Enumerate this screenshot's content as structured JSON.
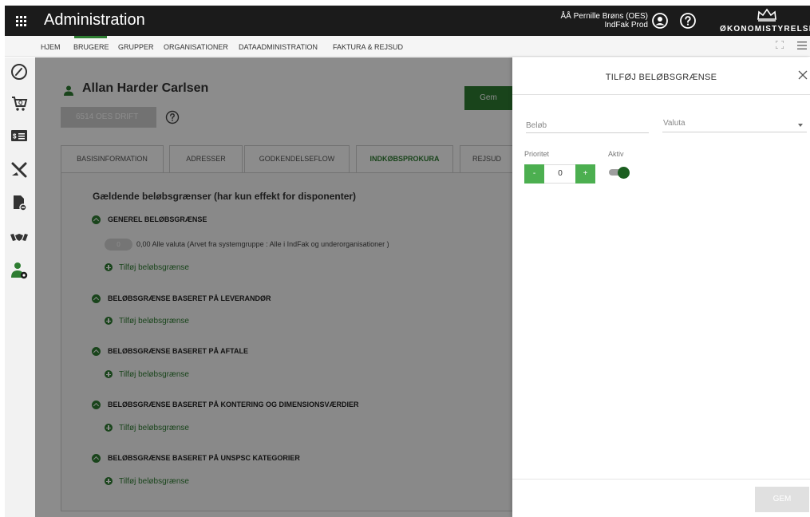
{
  "app": {
    "title": "Administration"
  },
  "user": {
    "name_line": "ÅÅ Pernille Brøns (OES)",
    "sub_line": "IndFak Prod"
  },
  "logo": {
    "text": "ØKONOMISTYRELSEN"
  },
  "nav": {
    "items": [
      {
        "label": "HJEM"
      },
      {
        "label": "BRUGERE"
      },
      {
        "label": "GRUPPER"
      },
      {
        "label": "ORGANISATIONER"
      },
      {
        "label": "DATAADMINISTRATION"
      },
      {
        "label": "FAKTURA & REJSUD"
      }
    ],
    "active": "BRUGERE"
  },
  "sidebar": {
    "icons": [
      "dashboard-icon",
      "cart-icon",
      "invoice-icon",
      "travel-icon",
      "document-icon",
      "handshake-icon",
      "user-settings-icon"
    ]
  },
  "main": {
    "user_name": "Allan Harder Carlsen",
    "save_label": "Gem",
    "org_label": "6514 OES DRIFT",
    "tabs": [
      {
        "label": "BASISINFORMATION"
      },
      {
        "label": "ADRESSER"
      },
      {
        "label": "GODKENDELSEFLOW"
      },
      {
        "label": "INDKØBSPROKURA"
      },
      {
        "label": "REJSUD"
      }
    ],
    "active_tab": "INDKØBSPROKURA",
    "section_title": "Gældende beløbsgrænser (har kun effekt for disponenter)",
    "groups": [
      {
        "title": "GENEREL BELØBSGRÆNSE",
        "add_label": "Tilføj beløbsgrænse"
      },
      {
        "title": "BELØBSGRÆNSE BASERET PÅ LEVERANDØR",
        "add_label": "Tilføj beløbsgrænse"
      },
      {
        "title": "BELØBSGRÆNSE BASERET PÅ AFTALE",
        "add_label": "Tilføj beløbsgrænse"
      },
      {
        "title": "BELØBSGRÆNSE BASERET PÅ KONTERING OG DIMENSIONSVÆRDIER",
        "add_label": "Tilføj beløbsgrænse"
      },
      {
        "title": "BELØBSGRÆNSE BASERET PÅ UNSPSC KATEGORIER",
        "add_label": "Tilføj beløbsgrænse"
      }
    ],
    "general_limit": {
      "pill": "0",
      "text": "0,00 Alle valuta (Arvet fra systemgruppe : Alle i IndFak og underorganisationer )"
    }
  },
  "panel": {
    "title": "TILFØJ BELØBSGRÆNSE",
    "amount_placeholder": "Beløb",
    "currency_placeholder": "Valuta",
    "priority_label": "Prioritet",
    "active_label": "Aktiv",
    "priority_value": "0",
    "minus_label": "-",
    "plus_label": "+",
    "active": true,
    "save_label": "GEM"
  },
  "colors": {
    "accent": "#2e7d32",
    "topbar": "#1b1b1b",
    "stepper": "#4caf50"
  }
}
